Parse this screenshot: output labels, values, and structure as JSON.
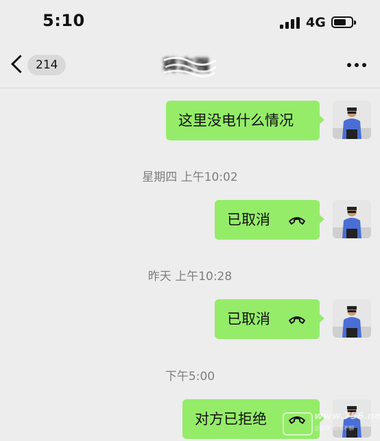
{
  "status": {
    "time": "5:10",
    "network": "4G",
    "signal_icon": "cellular-signal-icon",
    "battery_icon": "battery-icon"
  },
  "nav": {
    "back_icon": "chevron-left-icon",
    "unread_count": "214",
    "contact_name": "蒋志强",
    "more_icon": "ellipsis-icon"
  },
  "messages": [
    {
      "type": "text",
      "text": "这里没电什么情况"
    },
    {
      "type": "timestamp",
      "text": "星期四 上午10:02"
    },
    {
      "type": "call",
      "text": "已取消",
      "icon": "hang-up-phone-icon"
    },
    {
      "type": "timestamp",
      "text": "昨天 上午10:28"
    },
    {
      "type": "call",
      "text": "已取消",
      "icon": "hang-up-phone-icon"
    },
    {
      "type": "timestamp",
      "text": "下午5:00"
    },
    {
      "type": "call",
      "text": "对方已拒绝",
      "icon": "hang-up-phone-icon"
    }
  ],
  "watermark": {
    "text": "www.756.net",
    "subtext": "企业网 知书不解"
  },
  "colors": {
    "background": "#ededed",
    "bubble": "#95ec69",
    "timestamp": "#7d7d7d"
  }
}
